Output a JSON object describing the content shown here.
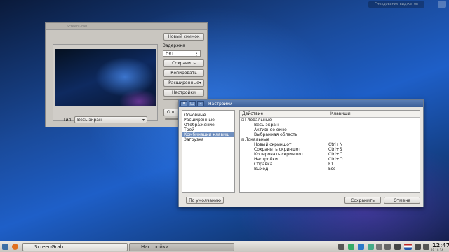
{
  "colors": {
    "accent": "#6f8fbf",
    "titlebar": "#3c5f98"
  },
  "desktop": {
    "top_hint": "Гнездование виджетов"
  },
  "screengrab": {
    "title": "ScreenGrab",
    "buttons": {
      "new_snapshot": "Новый снимок",
      "save": "Сохранить",
      "copy": "Копировать",
      "advanced": "Расширенные",
      "settings": "Настройки",
      "about": "О п"
    },
    "delay_label": "Задержка",
    "delay_value": "Нет",
    "type_label": "Тип:",
    "type_value": "Весь экран"
  },
  "settings_window": {
    "title": "Настройки",
    "categories": [
      "Основные",
      "Расширенные",
      "Отображение",
      "Трей",
      "Комбинации клавиш",
      "Загрузка"
    ],
    "selected_category": "Комбинации клавиш",
    "table": {
      "col_action": "Действие",
      "col_keys": "Клавиши",
      "rows": [
        {
          "action": "Глобальные",
          "keys": "",
          "group": true
        },
        {
          "action": "Весь экран",
          "keys": ""
        },
        {
          "action": "Активное окно",
          "keys": ""
        },
        {
          "action": "Выбранная область",
          "keys": ""
        },
        {
          "action": "Локальные",
          "keys": "",
          "group": true
        },
        {
          "action": "Новый скриншот",
          "keys": "Ctrl+N"
        },
        {
          "action": "Сохранить скриншот",
          "keys": "Ctrl+S"
        },
        {
          "action": "Копировать скриншот",
          "keys": "Ctrl+C"
        },
        {
          "action": "Настройки",
          "keys": "Ctrl+O"
        },
        {
          "action": "Справка",
          "keys": "F1"
        },
        {
          "action": "Выход",
          "keys": "Esc"
        }
      ]
    },
    "buttons": {
      "default": "По умолчанию",
      "save": "Сохранить",
      "cancel": "Отмена"
    }
  },
  "taskbar": {
    "tasks": [
      "ScreenGrab",
      "Настройки"
    ],
    "clock_time": "12:47",
    "clock_date": "19.10.14"
  }
}
